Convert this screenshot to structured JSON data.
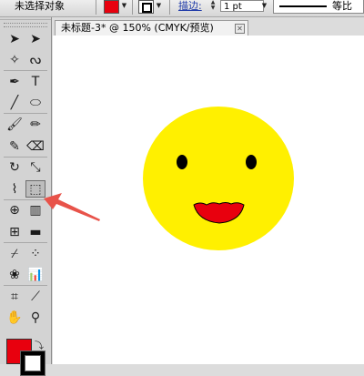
{
  "control_bar": {
    "selection_status": "未选择对象",
    "fill_color": "#e8000e",
    "stroke_label": "描边:",
    "stroke_weight": "1 pt",
    "profile_label": "等比"
  },
  "toolbox": {
    "tools": [
      {
        "name": "selection-tool-icon",
        "glyph": "➤"
      },
      {
        "name": "direct-selection-tool-icon",
        "glyph": "➤"
      },
      {
        "name": "magic-wand-tool-icon",
        "glyph": "✧"
      },
      {
        "name": "lasso-tool-icon",
        "glyph": "ᔓ"
      },
      {
        "name": "pen-tool-icon",
        "glyph": "✒"
      },
      {
        "name": "type-tool-icon",
        "glyph": "T"
      },
      {
        "name": "line-segment-tool-icon",
        "glyph": "╱"
      },
      {
        "name": "ellipse-tool-icon",
        "glyph": "⬭"
      },
      {
        "name": "paintbrush-tool-icon",
        "glyph": "🖌"
      },
      {
        "name": "pencil-tool-icon",
        "glyph": "✏"
      },
      {
        "name": "blob-brush-tool-icon",
        "glyph": "✎"
      },
      {
        "name": "eraser-tool-icon",
        "glyph": "⌫"
      },
      {
        "name": "rotate-tool-icon",
        "glyph": "↻"
      },
      {
        "name": "scale-tool-icon",
        "glyph": "⤡"
      },
      {
        "name": "width-tool-icon",
        "glyph": "⌇"
      },
      {
        "name": "free-transform-tool-icon",
        "glyph": "⬚"
      },
      {
        "name": "shape-builder-tool-icon",
        "glyph": "⊕"
      },
      {
        "name": "live-paint-bucket-tool-icon",
        "glyph": "▥"
      },
      {
        "name": "mesh-tool-icon",
        "glyph": "⊞"
      },
      {
        "name": "gradient-tool-icon",
        "glyph": "▬"
      },
      {
        "name": "eyedropper-tool-icon",
        "glyph": "⌿"
      },
      {
        "name": "blend-tool-icon",
        "glyph": "⁘"
      },
      {
        "name": "symbol-sprayer-tool-icon",
        "glyph": "❀"
      },
      {
        "name": "column-graph-tool-icon",
        "glyph": "📊"
      },
      {
        "name": "artboard-tool-icon",
        "glyph": "⌗"
      },
      {
        "name": "slice-tool-icon",
        "glyph": "⟋"
      },
      {
        "name": "hand-tool-icon",
        "glyph": "✋"
      },
      {
        "name": "zoom-tool-icon",
        "glyph": "⚲"
      }
    ],
    "active_tool": "free-transform-tool-icon",
    "fill_color": "#e8000e",
    "stroke_color": "#000000"
  },
  "document": {
    "tab_title": "未标题-3* @ 150% (CMYK/预览)",
    "close_icon": "close-icon"
  },
  "artwork": {
    "face_color": "#fff000",
    "eye_color": "#000000",
    "mouth_color": "#e8000e"
  },
  "annotation": {
    "arrow_color": "#e8534a"
  }
}
